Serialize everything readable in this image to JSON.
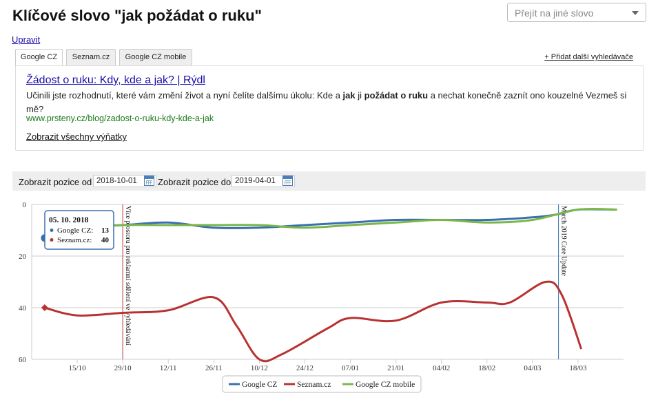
{
  "header": {
    "title": "Klíčové slovo \"jak požádat o ruku\"",
    "goto_placeholder": "Přejít na jiné slovo",
    "edit_label": "Upravit"
  },
  "tabs": [
    {
      "label": "Google CZ",
      "active": true
    },
    {
      "label": "Seznam.cz",
      "active": false
    },
    {
      "label": "Google CZ mobile",
      "active": false
    }
  ],
  "add_engine_label": "+ Přidat další vyhledávače",
  "result": {
    "title": "Žádost o ruku: Kdy, kde a jak? | Rýdl",
    "snippet_parts": [
      {
        "text": "Učinili jste rozhodnutí, které vám změní život a nyní čelíte dalšímu úkolu: Kde a ",
        "bold": false
      },
      {
        "text": "jak",
        "bold": true
      },
      {
        "text": " ji ",
        "bold": false
      },
      {
        "text": "požádat o ruku",
        "bold": true
      },
      {
        "text": " a nechat konečně zaznít ono kouzelné Vezmeš si mě?",
        "bold": false
      }
    ],
    "url": "www.prsteny.cz/blog/zadost-o-ruku-kdy-kde-a-jak",
    "show_all_label": "Zobrazit všechny výňatky"
  },
  "range": {
    "from_label": "Zobrazit pozice od",
    "from_value": "2018-10-01",
    "to_label": "Zobrazit pozice do",
    "to_value": "2019-04-01"
  },
  "chart_data": {
    "type": "line",
    "y_reversed": true,
    "ylim": [
      0,
      60
    ],
    "y_ticks": [
      0,
      20,
      40,
      60
    ],
    "x_range": [
      "2018-10-01",
      "2019-04-01"
    ],
    "x_ticks": [
      "15/10",
      "29/10",
      "12/11",
      "26/11",
      "10/12",
      "24/12",
      "07/01",
      "21/01",
      "04/02",
      "18/02",
      "04/03",
      "18/03"
    ],
    "grid": true,
    "legend_position": "bottom-center",
    "series": [
      {
        "name": "Google CZ",
        "color": "#3a6fb0",
        "x": [
          "2018-10-05",
          "2018-10-15",
          "2018-10-29",
          "2018-11-12",
          "2018-11-26",
          "2018-12-10",
          "2018-12-24",
          "2019-01-07",
          "2019-01-21",
          "2019-02-04",
          "2019-02-18",
          "2019-03-04",
          "2019-03-11",
          "2019-03-18",
          "2019-03-30"
        ],
        "values": [
          13,
          9,
          8,
          7,
          9,
          9,
          8,
          7,
          6,
          6,
          6,
          5,
          4,
          2,
          2
        ]
      },
      {
        "name": "Seznam.cz",
        "color": "#b83232",
        "x": [
          "2018-10-05",
          "2018-10-15",
          "2018-10-29",
          "2018-11-12",
          "2018-11-26",
          "2018-12-03",
          "2018-12-10",
          "2018-12-17",
          "2018-12-31",
          "2019-01-07",
          "2019-01-21",
          "2019-02-04",
          "2019-02-18",
          "2019-02-25",
          "2019-03-08",
          "2019-03-13",
          "2019-03-19"
        ],
        "values": [
          40,
          43,
          42,
          41,
          36,
          47,
          60,
          58,
          48,
          44,
          45,
          38,
          38,
          38,
          30,
          35,
          56
        ]
      },
      {
        "name": "Google CZ mobile",
        "color": "#7ab648",
        "x": [
          "2018-10-05",
          "2018-10-15",
          "2018-10-29",
          "2018-11-12",
          "2018-11-26",
          "2018-12-10",
          "2018-12-24",
          "2019-01-07",
          "2019-01-21",
          "2019-02-04",
          "2019-02-18",
          "2019-03-04",
          "2019-03-18",
          "2019-03-30"
        ],
        "values": [
          13,
          9,
          8,
          8,
          8,
          8,
          9,
          8,
          7,
          6,
          7,
          6,
          2,
          2
        ]
      }
    ],
    "annotations": [
      {
        "date": "2018-10-29",
        "label": "Více prostoru pro reklamní sdělení ve vyhledávání",
        "color": "#b83232"
      },
      {
        "date": "2019-03-12",
        "label": "March 2019 Core Update",
        "color": "#3a6fb0"
      }
    ],
    "tooltip": {
      "date": "05. 10. 2018",
      "rows": [
        {
          "name": "Google CZ:",
          "value": "13",
          "color": "#3a6fb0"
        },
        {
          "name": "Seznam.cz:",
          "value": "40",
          "color": "#b83232"
        }
      ]
    }
  }
}
